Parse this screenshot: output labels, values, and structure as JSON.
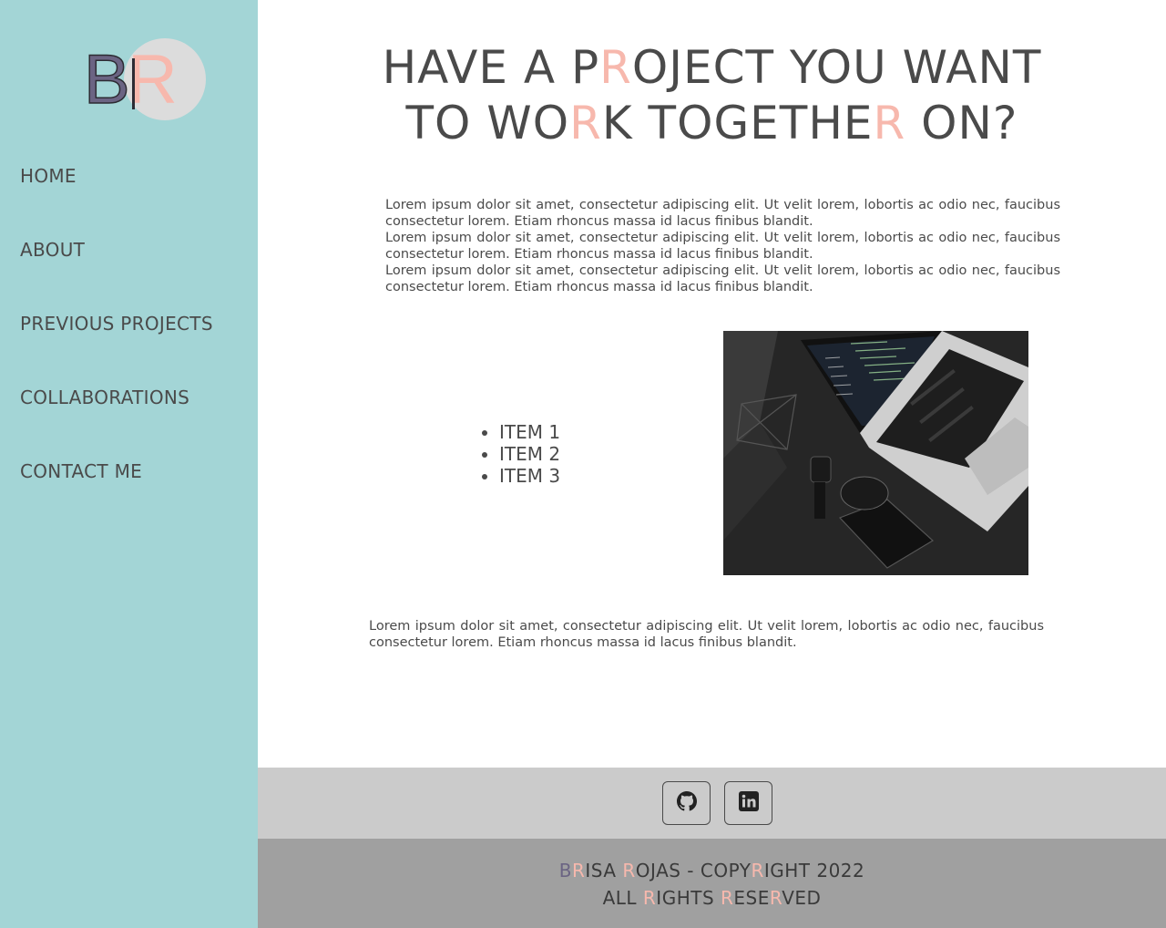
{
  "sidebar": {
    "logo": {
      "letters": [
        "B",
        "R"
      ]
    },
    "nav": [
      {
        "label": "HOME"
      },
      {
        "label": "ABOUT"
      },
      {
        "label": "PREVIOUS PROJECTS"
      },
      {
        "label": "COLLABORATIONS"
      },
      {
        "label": "CONTACT ME"
      }
    ]
  },
  "main": {
    "headline": {
      "line1": [
        "HAVE A P",
        "R",
        "OJECT YOU WANT"
      ],
      "line2": [
        "TO WO",
        "R",
        "K TOGETHE",
        "R",
        " ON?"
      ]
    },
    "intro_paragraphs": [
      "Lorem ipsum dolor sit amet, consectetur adipiscing elit. Ut velit lorem, lobortis ac odio nec, faucibus consectetur lorem. Etiam rhoncus massa id lacus finibus blandit.",
      "Lorem ipsum dolor sit amet, consectetur adipiscing elit. Ut velit lorem, lobortis ac odio nec, faucibus consectetur lorem. Etiam rhoncus massa id lacus finibus blandit.",
      "Lorem ipsum dolor sit amet, consectetur adipiscing elit. Ut velit lorem, lobortis ac odio nec, faucibus consectetur lorem. Etiam rhoncus massa id lacus finibus blandit."
    ],
    "items": [
      "ITEM 1",
      "ITEM 2",
      "ITEM 3"
    ],
    "outro": "Lorem ipsum dolor sit amet, consectetur adipiscing elit. Ut velit lorem, lobortis ac odio nec, faucibus consectetur lorem. Etiam rhoncus massa id lacus finibus blandit."
  },
  "social": [
    {
      "icon": "github-icon"
    },
    {
      "icon": "linkedin-icon"
    }
  ],
  "footer": {
    "line1": [
      "B",
      "R",
      "ISA ",
      "R",
      "OJAS - COPY",
      "R",
      "IGHT 2022"
    ],
    "line2": [
      "ALL ",
      "R",
      "IGHTS ",
      "R",
      "ESE",
      "R",
      "VED"
    ]
  },
  "colors": {
    "sidebar_bg": "#a3d5d6",
    "accent_pink": "#f7b8ad",
    "accent_purple": "#6b6483",
    "text": "#4a4a4a",
    "social_bar_bg": "#cbcbcb",
    "footer_bg": "#a0a0a0"
  }
}
